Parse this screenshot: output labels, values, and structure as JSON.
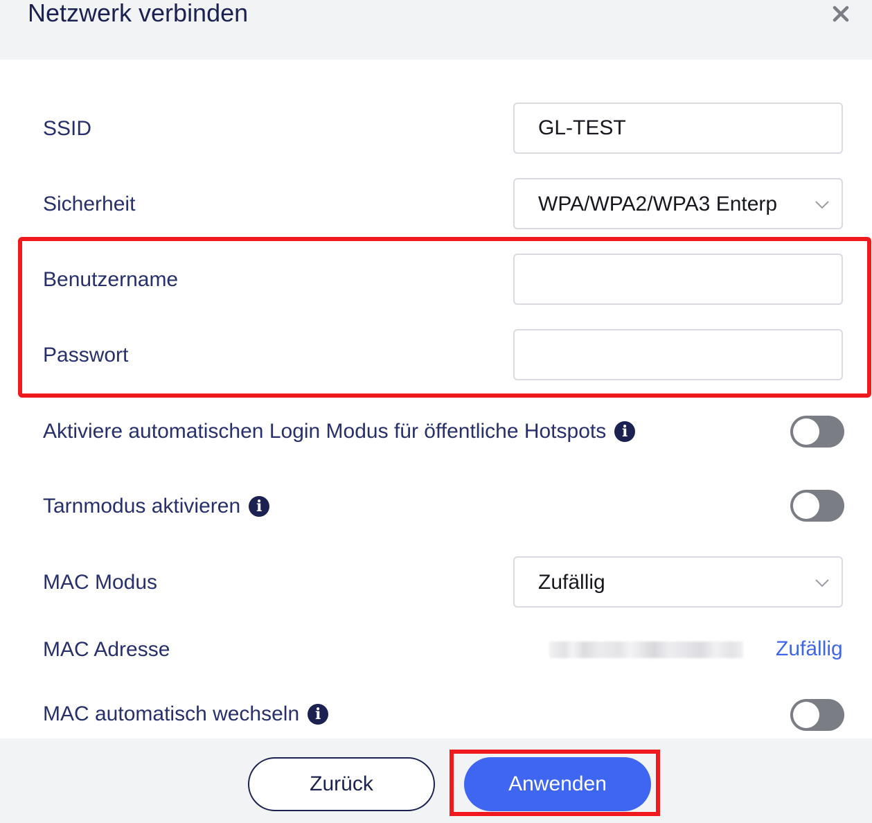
{
  "dialog": {
    "title": "Netzwerk verbinden",
    "close_icon": "close-icon"
  },
  "form": {
    "ssid": {
      "label": "SSID",
      "value": "GL-TEST"
    },
    "security": {
      "label": "Sicherheit",
      "value": "WPA/WPA2/WPA3 Enterp",
      "icon": "chevron-down-icon"
    },
    "username": {
      "label": "Benutzername",
      "value": ""
    },
    "password": {
      "label": "Passwort",
      "value": ""
    },
    "auto_login": {
      "label": "Aktiviere automatischen Login Modus für öffentliche Hotspots",
      "info_icon": "i",
      "enabled": false
    },
    "stealth_mode": {
      "label": "Tarnmodus aktivieren",
      "info_icon": "i",
      "enabled": false
    },
    "mac_mode": {
      "label": "MAC Modus",
      "value": "Zufällig",
      "icon": "chevron-down-icon"
    },
    "mac_address": {
      "label": "MAC Adresse",
      "random_link": "Zufällig"
    },
    "mac_auto_change": {
      "label": "MAC automatisch wechseln",
      "info_icon": "i",
      "enabled": false
    }
  },
  "footer": {
    "back_label": "Zurück",
    "apply_label": "Anwenden"
  },
  "colors": {
    "highlight": "#f0191e",
    "primary": "#3f66f0",
    "link": "#3f66e8",
    "text": "#27306a",
    "toggle_off": "#7a7d83"
  }
}
